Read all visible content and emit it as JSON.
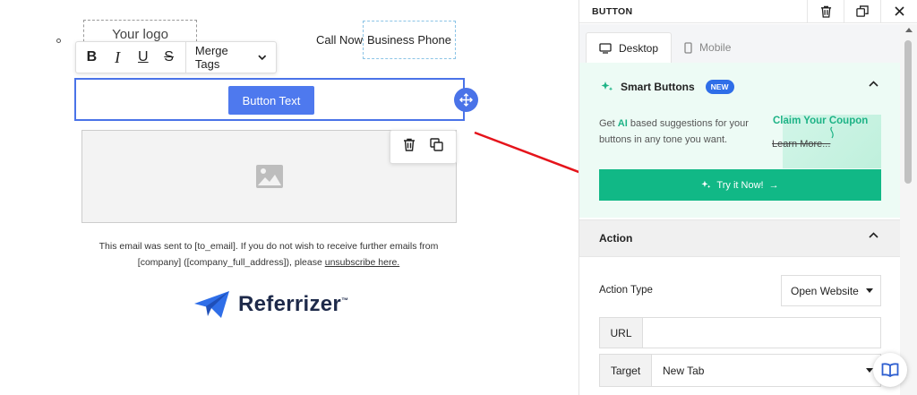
{
  "canvas": {
    "logo_placeholder": "Your logo",
    "call_now": "Call Now",
    "business_phone": "Business Phone",
    "format_toolbar": {
      "bold": "B",
      "italic": "I",
      "underline": "U",
      "strike": "S",
      "merge_tags": "Merge Tags"
    },
    "button_text": "Button Text",
    "footer": {
      "line": "This email was sent to [to_email]. If you do not wish to receive further emails from [company] ([company_full_address]), please ",
      "unsubscribe": "unsubscribe here."
    },
    "brand": {
      "name": "Referrizer",
      "tm": "™"
    }
  },
  "panel": {
    "title": "BUTTON",
    "tabs": [
      {
        "label": "Desktop",
        "icon": "desktop-icon",
        "active": true
      },
      {
        "label": "Mobile",
        "icon": "mobile-icon",
        "active": false
      }
    ],
    "smart_buttons": {
      "title": "Smart Buttons",
      "badge": "NEW",
      "desc_prefix": "Get ",
      "desc_ai": "AI",
      "desc_suffix": " based suggestions for your buttons in any tone you want.",
      "claim": "Claim Your Coupon",
      "learn_more": "Learn More...",
      "try_label": "Try it Now!",
      "try_arrow": "→"
    },
    "action": {
      "title": "Action",
      "action_type_label": "Action Type",
      "action_type_value": "Open Website",
      "url_label": "URL",
      "url_value": "",
      "target_label": "Target",
      "target_value": "New Tab"
    }
  },
  "colors": {
    "accent_blue": "#4e79ee",
    "smart_green": "#11b886",
    "badge_blue": "#2f6ee8",
    "arrow_red": "#e5141b"
  }
}
